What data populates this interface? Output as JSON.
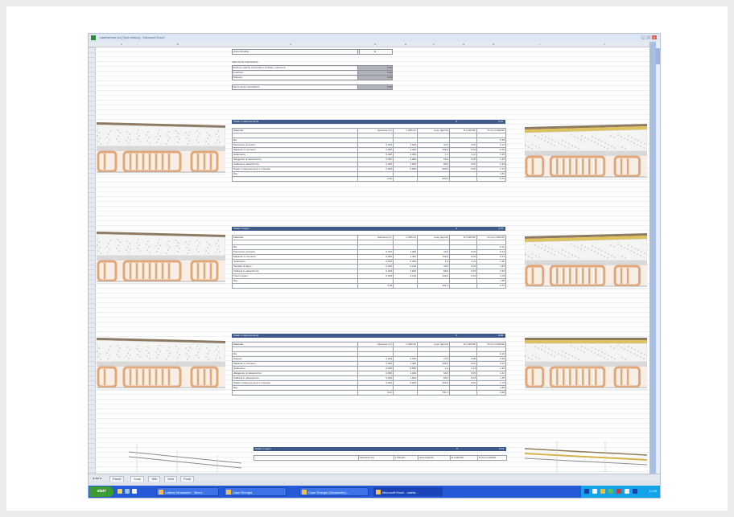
{
  "window": {
    "title": "calefazione.xls [Sola lettura] - Microsoft Excel",
    "controls": [
      "_",
      "□",
      "×"
    ]
  },
  "columns": [
    "A",
    "B",
    "C",
    "D",
    "E",
    "F",
    "G",
    "H",
    "I",
    "J"
  ],
  "top_section": {
    "row1_label": "Zona climatica",
    "row1_value": "E",
    "subtitle": "Valori limite trasmittanza",
    "rows": [
      {
        "label": "Strutture opache orizzontali o inclinate, pavimenti",
        "value": "0,30"
      },
      {
        "label": "Coperture",
        "value": "0,30"
      },
      {
        "label": "Chiusure",
        "value": "0,29"
      }
    ],
    "bottom_label": "Valore limite trasmittanza",
    "bottom_value": "0,30"
  },
  "blocks": [
    {
      "title": "Solaio in laterocemento",
      "head_mid": "U",
      "head_value": "0,70",
      "headers": [
        "Materiale",
        "Spessore (m)",
        "λ (W/mK)",
        "peso (kg/m2)",
        "R (m2K/W)",
        "R cum (m2K/W)"
      ],
      "rows": [
        [
          "",
          "",
          "",
          "",
          "",
          ""
        ],
        [
          "Rsi",
          "",
          "",
          "",
          "",
          "0,10"
        ],
        [
          "Pavimento ceramico",
          "0,015",
          "1,000",
          "33,0",
          "0,02",
          "0,12"
        ],
        [
          "Massetto in cemento",
          "0,050",
          "1,400",
          "100,0",
          "0,04",
          "0,16"
        ],
        [
          "Isolamento",
          "0,040",
          "0,035",
          "1,2",
          "1,14",
          "1,30"
        ],
        [
          "Alleggerito di calcestruzzo",
          "0,060",
          "1,000",
          "60,0",
          "0,06",
          "1,36"
        ],
        [
          "Caldana in calcestruzzo",
          "0,040",
          "1,600",
          "80,0",
          "0,03",
          "1,39"
        ],
        [
          "Solaio in laterocemento e intonaco",
          "0,200",
          "0,600",
          "260,0",
          "0,33",
          "1,72"
        ],
        [
          "Rse",
          "",
          "",
          "",
          "",
          "1,82"
        ]
      ],
      "total": [
        "",
        "0,40",
        "",
        "534,2",
        "",
        "0,70"
      ]
    },
    {
      "title": "Solaio in legno",
      "head_mid": "U",
      "head_value": "0,75",
      "headers": [
        "Materiale",
        "Spessore (m)",
        "λ (W/mK)",
        "peso (kg/m2)",
        "R (m2K/W)",
        "R cum (m2K/W)"
      ],
      "rows": [
        [
          "",
          "",
          "",
          "",
          "",
          ""
        ],
        [
          "Rsi",
          "",
          "",
          "",
          "",
          "0,10"
        ],
        [
          "Pavimento ceramico",
          "0,015",
          "1,000",
          "33,0",
          "0,02",
          "0,12"
        ],
        [
          "Massetto in cemento",
          "0,050",
          "1,400",
          "100,0",
          "0,04",
          "0,16"
        ],
        [
          "Isolamento",
          "0,040",
          "0,035",
          "1,2",
          "1,14",
          "1,30"
        ],
        [
          "Tavolato di legno",
          "0,030",
          "0,130",
          "18,0",
          "0,23",
          "1,53"
        ],
        [
          "Caldana in calcestruzzo",
          "0,040",
          "1,600",
          "80,0",
          "0,03",
          "1,56"
        ],
        [
          "Travi in legno",
          "0,200",
          "0,130",
          "100,0",
          "0,22",
          "1,78"
        ],
        [
          "Rse",
          "",
          "",
          "",
          "",
          "1,88"
        ]
      ],
      "total": [
        "",
        "0,38",
        "",
        "331,2",
        "",
        "0,75"
      ]
    },
    {
      "title": "Solaio in laterocemento",
      "head_mid": "U",
      "head_value": "0,68",
      "headers": [
        "Materiale",
        "Spessore (m)",
        "λ (W/mK)",
        "peso (kg/m2)",
        "R (m2K/W)",
        "R cum (m2K/W)"
      ],
      "rows": [
        [
          "",
          "",
          "",
          "",
          "",
          ""
        ],
        [
          "Rsi",
          "",
          "",
          "",
          "",
          "0,10"
        ],
        [
          "Parquet",
          "0,015",
          "0,180",
          "10,5",
          "0,08",
          "0,18"
        ],
        [
          "Massetto in cemento",
          "0,050",
          "1,400",
          "100,0",
          "0,04",
          "0,22"
        ],
        [
          "Isolamento",
          "0,040",
          "0,035",
          "1,2",
          "1,14",
          "1,36"
        ],
        [
          "Alleggerito di calcestruzzo",
          "0,060",
          "1,000",
          "60,0",
          "0,06",
          "1,42"
        ],
        [
          "Caldana in calcestruzzo",
          "0,040",
          "1,600",
          "80,0",
          "0,03",
          "1,45"
        ],
        [
          "Solaio in laterocemento e intonaco",
          "0,200",
          "0,600",
          "260,0",
          "0,33",
          "1,78"
        ],
        [
          "Rse",
          "",
          "",
          "",
          "",
          "1,88"
        ]
      ],
      "total": [
        "",
        "0,40",
        "",
        "511,7",
        "",
        "0,68"
      ]
    }
  ],
  "partial_block": {
    "title": "Solaio in legno",
    "head_mid": "U",
    "head_value": "0,72",
    "headers": [
      "",
      "Spessore (m)",
      "λ (W/mK)",
      "peso (kg/m2)",
      "R (m2K/W)",
      "R cum (m2K/W)"
    ]
  },
  "sheet_tabs": [
    "Pareti",
    "Solai",
    "Tetti",
    "Vetri",
    "Ponti"
  ],
  "active_tab": "Solai",
  "taskbar": {
    "start": "start",
    "buttons": [
      "Lettera Dinamiche - Micro...",
      "Case Energia",
      "Case Energia (Dinamiche)...",
      "Microsoft Excel - calefa..."
    ],
    "active_button": 3,
    "clock": "11:05"
  },
  "colors": {
    "header_blue": "#3d5a8a",
    "taskbar": "#2459d8",
    "start": "#3c9a33",
    "brick": "#e1a778"
  }
}
